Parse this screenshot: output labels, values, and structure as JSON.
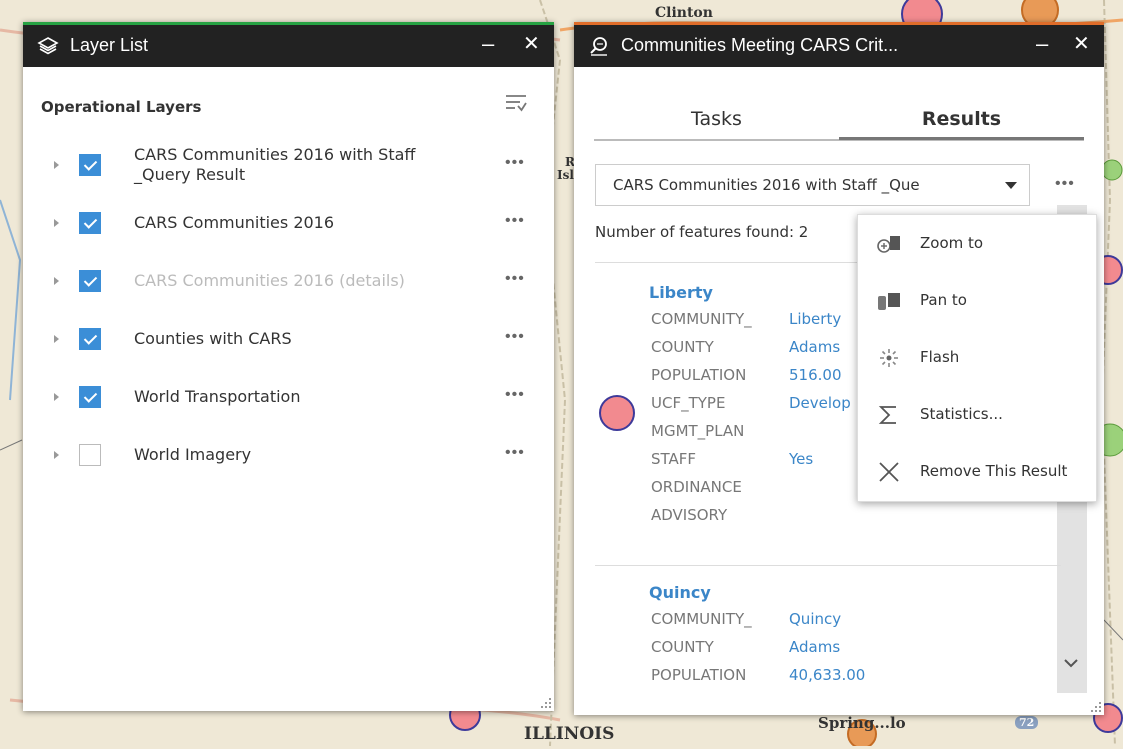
{
  "map": {
    "labels": [
      "Clinton",
      "ILLINOIS",
      "Spring...lo",
      "R",
      "Isl",
      "72"
    ]
  },
  "layer_list": {
    "title": "Layer List",
    "minimize": "–",
    "close": "✕",
    "section_title": "Operational Layers",
    "more": "•••",
    "layers": [
      {
        "label": "CARS Communities 2016 with Staff _Query Result",
        "checked": true,
        "dim": false
      },
      {
        "label": "CARS Communities 2016",
        "checked": true,
        "dim": false
      },
      {
        "label": "CARS Communities 2016 (details)",
        "checked": true,
        "dim": true
      },
      {
        "label": "Counties with CARS",
        "checked": true,
        "dim": false
      },
      {
        "label": "World Transportation",
        "checked": true,
        "dim": false
      },
      {
        "label": "World Imagery",
        "checked": false,
        "dim": false
      }
    ]
  },
  "communities": {
    "title": "Communities Meeting CARS Crit...",
    "minimize": "–",
    "close": "✕",
    "tabs": [
      {
        "label": "Tasks",
        "active": false
      },
      {
        "label": "Results",
        "active": true
      }
    ],
    "select_value": "CARS Communities 2016 with Staff _Que",
    "more": "•••",
    "found_text": "Number of features found: 2",
    "results": [
      {
        "name": "Liberty",
        "fields": [
          {
            "key": "COMMUNITY_",
            "value": "Liberty"
          },
          {
            "key": "COUNTY",
            "value": "Adams"
          },
          {
            "key": "POPULATION",
            "value": "516.00"
          },
          {
            "key": "UCF_TYPE",
            "value": "Develop"
          },
          {
            "key": "MGMT_PLAN",
            "value": ""
          },
          {
            "key": "STAFF",
            "value": "Yes"
          },
          {
            "key": "ORDINANCE",
            "value": ""
          },
          {
            "key": "ADVISORY",
            "value": ""
          }
        ]
      },
      {
        "name": "Quincy",
        "fields": [
          {
            "key": "COMMUNITY_",
            "value": "Quincy"
          },
          {
            "key": "COUNTY",
            "value": "Adams"
          },
          {
            "key": "POPULATION",
            "value": "40,633.00"
          }
        ]
      }
    ],
    "menu": [
      {
        "label": "Zoom to",
        "icon": "zoom-to-icon"
      },
      {
        "label": "Pan to",
        "icon": "pan-to-icon"
      },
      {
        "label": "Flash",
        "icon": "flash-icon"
      },
      {
        "label": "Statistics...",
        "icon": "statistics-icon"
      },
      {
        "label": "Remove This Result",
        "icon": "close-icon"
      }
    ]
  },
  "colors": {
    "layer_panel_accent": "#27a243",
    "comm_panel_accent": "#e06d2a",
    "link_blue": "#3b86c8",
    "check_blue": "#3b8ed7",
    "marker_fill": "#f28a8f",
    "marker_stroke": "#3e3a9a"
  }
}
